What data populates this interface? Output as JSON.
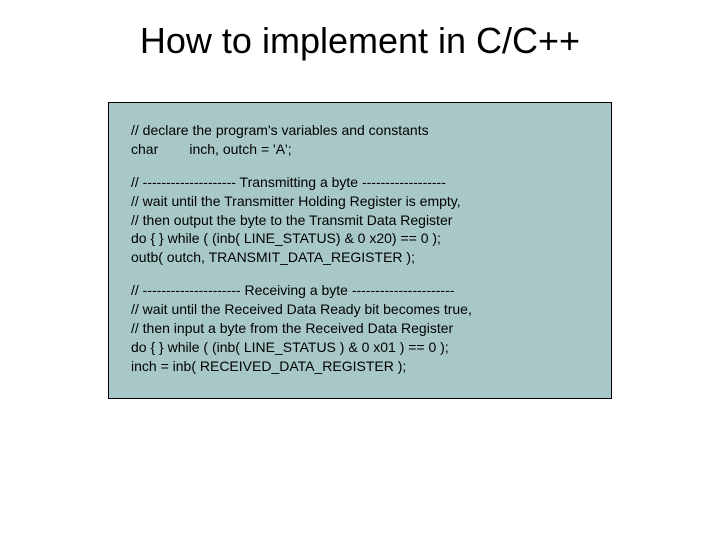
{
  "title": "How to implement in C/C++",
  "block1": {
    "l1": "// declare the program's variables and constants",
    "l2": "char        inch, outch = 'A';"
  },
  "block2": {
    "l1": "// -------------------- Transmitting a byte ------------------",
    "l2": "// wait until the Transmitter Holding Register is empty,",
    "l3": "// then output the byte to the Transmit Data Register",
    "l4": "do { } while ( (inb( LINE_STATUS) & 0 x20) == 0 );",
    "l5": "outb( outch, TRANSMIT_DATA_REGISTER );"
  },
  "block3": {
    "l1": "// --------------------- Receiving a byte ----------------------",
    "l2": "// wait until the Received Data Ready bit becomes true,",
    "l3": "// then input a byte from the Received Data Register",
    "l4": "do { } while ( (inb( LINE_STATUS ) & 0 x01 ) == 0 );",
    "l5": "inch = inb( RECEIVED_DATA_REGISTER );"
  }
}
